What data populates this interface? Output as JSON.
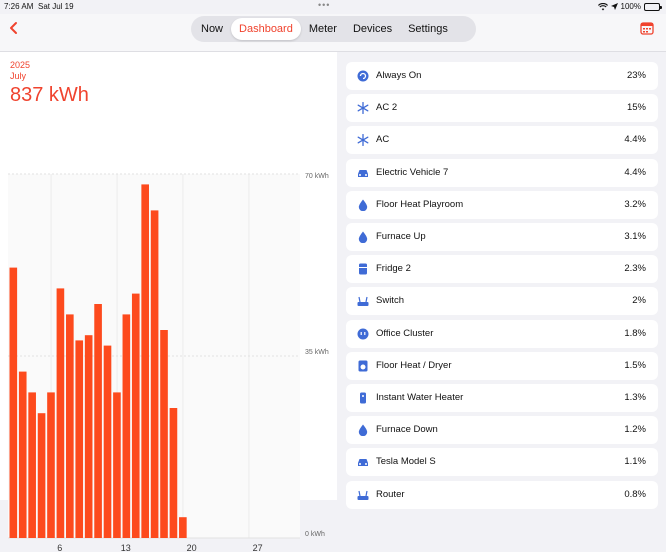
{
  "status": {
    "time": "7:26 AM",
    "date": "Sat Jul 19",
    "battery": "100%"
  },
  "nav": {
    "tabs": [
      {
        "label": "Now",
        "active": false
      },
      {
        "label": "Dashboard",
        "active": true
      },
      {
        "label": "Meter",
        "active": false
      },
      {
        "label": "Devices",
        "active": false
      },
      {
        "label": "Settings",
        "active": false
      }
    ]
  },
  "summary": {
    "year": "2025",
    "month": "July",
    "total": "837 kWh"
  },
  "chart_data": {
    "type": "bar",
    "x": [
      1,
      2,
      3,
      4,
      5,
      6,
      7,
      8,
      9,
      10,
      11,
      12,
      13,
      14,
      15,
      16,
      17,
      18,
      19
    ],
    "values": [
      52,
      32,
      28,
      24,
      28,
      48,
      43,
      38,
      39,
      45,
      37,
      28,
      43,
      47,
      68,
      63,
      40,
      25,
      4
    ],
    "xticks": [
      "6",
      "13",
      "20",
      "27"
    ],
    "xtick_values": [
      6,
      13,
      20,
      27
    ],
    "xlim": [
      1,
      31
    ],
    "yticks": [
      "0 kWh",
      "35 kWh",
      "70 kWh"
    ],
    "ylim": [
      0,
      70
    ],
    "bar_color": "#fd4a1d",
    "title": "",
    "xlabel": "",
    "ylabel": ""
  },
  "devices": [
    {
      "name": "Always On",
      "pct": "23%",
      "icon": "always-on-icon"
    },
    {
      "name": "AC 2",
      "pct": "15%",
      "icon": "snowflake-icon"
    },
    {
      "name": "AC",
      "pct": "4.4%",
      "icon": "snowflake-icon"
    },
    {
      "name": "Electric Vehicle 7",
      "pct": "4.4%",
      "icon": "car-icon"
    },
    {
      "name": "Floor Heat Playroom",
      "pct": "3.2%",
      "icon": "drop-icon"
    },
    {
      "name": "Furnace Up",
      "pct": "3.1%",
      "icon": "drop-icon"
    },
    {
      "name": "Fridge 2",
      "pct": "2.3%",
      "icon": "fridge-icon"
    },
    {
      "name": "Switch",
      "pct": "2%",
      "icon": "router-icon"
    },
    {
      "name": "Office Cluster",
      "pct": "1.8%",
      "icon": "outlet-icon"
    },
    {
      "name": "Floor Heat / Dryer",
      "pct": "1.5%",
      "icon": "dryer-icon"
    },
    {
      "name": "Instant Water Heater",
      "pct": "1.3%",
      "icon": "water-heater-icon"
    },
    {
      "name": "Furnace Down",
      "pct": "1.2%",
      "icon": "drop-icon"
    },
    {
      "name": "Tesla Model S",
      "pct": "1.1%",
      "icon": "car-icon"
    },
    {
      "name": "Router",
      "pct": "0.8%",
      "icon": "router-icon"
    }
  ],
  "colors": {
    "accent": "#f0432e",
    "icon": "#3f6bd6"
  }
}
